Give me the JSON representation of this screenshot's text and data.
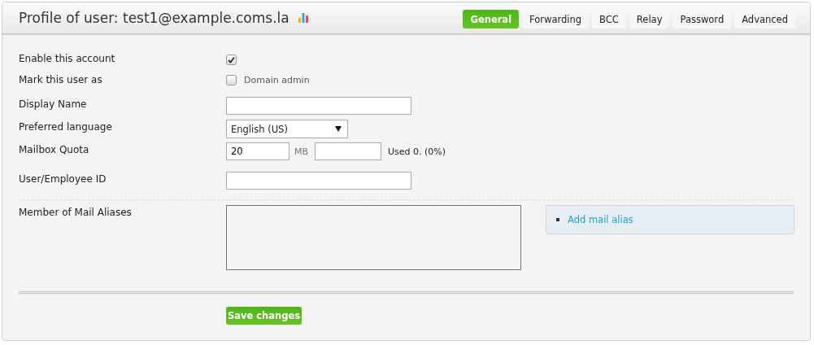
{
  "header": {
    "title": "Profile of user: test1@example.coms.la"
  },
  "tabs": [
    {
      "label": "General",
      "selected": true
    },
    {
      "label": "Forwarding",
      "selected": false
    },
    {
      "label": "BCC",
      "selected": false
    },
    {
      "label": "Relay",
      "selected": false
    },
    {
      "label": "Password",
      "selected": false
    },
    {
      "label": "Advanced",
      "selected": false
    }
  ],
  "enable_account": {
    "label": "Enable this account",
    "checked": true
  },
  "mark_user": {
    "label": "Mark this user as",
    "option": "Domain admin",
    "checked": false
  },
  "display_name": {
    "label": "Display Name"
  },
  "language": {
    "label": "Preferred language",
    "value": "English (US)"
  },
  "quota": {
    "label": "Mailbox Quota",
    "value": "20",
    "unit": "MB",
    "usage": "Used 0. (0%)"
  },
  "employee_id": {
    "label": "User/Employee ID"
  },
  "aliases": {
    "label": "Member of Mail Aliases",
    "add_link": "Add mail alias"
  },
  "save_button": "Save changes"
}
